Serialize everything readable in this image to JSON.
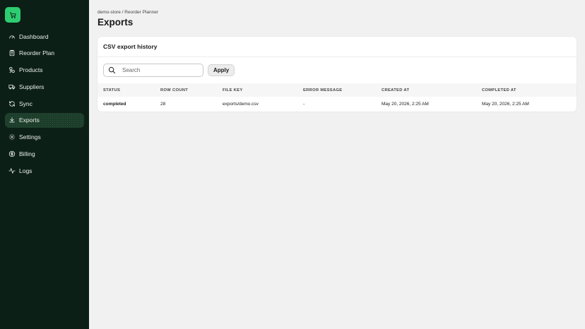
{
  "breadcrumb": "demo-store / Reorder Planner",
  "page_title": "Exports",
  "sidebar": {
    "logo_icon": "cart-icon",
    "accent_color": "#2ecc71",
    "items": [
      {
        "label": "Dashboard",
        "icon": "gauge-icon",
        "active": false
      },
      {
        "label": "Reorder Plan",
        "icon": "clipboard-icon",
        "active": false
      },
      {
        "label": "Products",
        "icon": "boxes-icon",
        "active": false
      },
      {
        "label": "Suppliers",
        "icon": "truck-icon",
        "active": false
      },
      {
        "label": "Sync",
        "icon": "refresh-icon",
        "active": false
      },
      {
        "label": "Exports",
        "icon": "download-icon",
        "active": true
      },
      {
        "label": "Settings",
        "icon": "gear-icon",
        "active": false
      },
      {
        "label": "Billing",
        "icon": "dollar-icon",
        "active": false
      },
      {
        "label": "Logs",
        "icon": "activity-icon",
        "active": false
      }
    ]
  },
  "card": {
    "title": "CSV export history",
    "search": {
      "placeholder": "Search",
      "value": ""
    },
    "apply_label": "Apply",
    "table": {
      "headers": [
        "STATUS",
        "ROW COUNT",
        "FILE KEY",
        "ERROR MESSAGE",
        "CREATED AT",
        "COMPLETED AT"
      ],
      "rows": [
        [
          "completed",
          "28",
          "exports/demo.csv",
          "-",
          "May 20, 2026, 2:25 AM",
          "May 20, 2026, 2:25 AM"
        ]
      ]
    }
  }
}
